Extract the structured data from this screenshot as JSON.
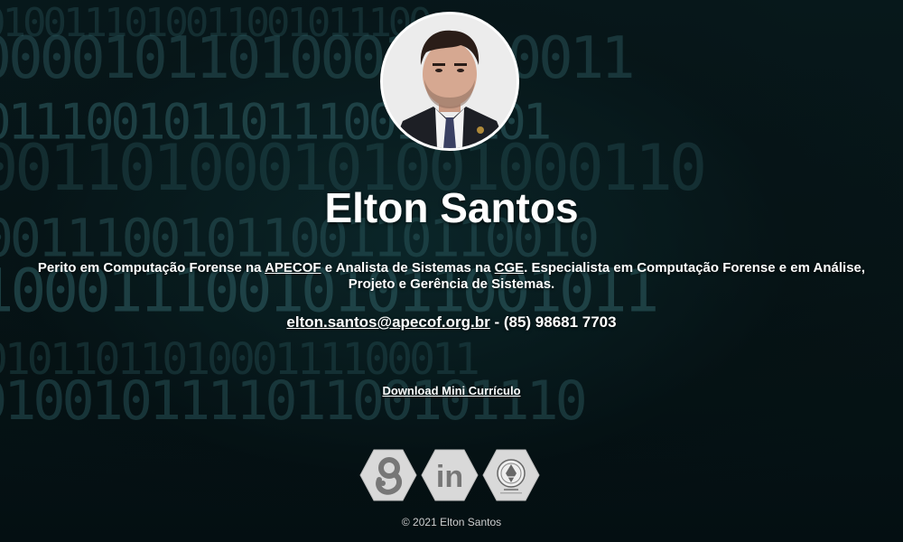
{
  "profile": {
    "name": "Elton Santos",
    "bio": {
      "t1": "Perito em Computação Forense na ",
      "link1": "APECOF",
      "t2": " e Analista de Sistemas na ",
      "link2": "CGE",
      "t3": ". Especialista em Computação Forense e em Análise, Projeto e Gerência de Sistemas."
    },
    "email": "elton.santos@apecof.org.br",
    "phone": " - (85) 98681 7703",
    "download_label": "Download Mini Currículo"
  },
  "social": [
    {
      "name": "lattes",
      "icon": "lattes-logo-icon"
    },
    {
      "name": "linkedin",
      "icon": "linkedin-icon",
      "glyph": "in"
    },
    {
      "name": "apecof",
      "icon": "apecof-seal-icon"
    }
  ],
  "footer": "© 2021 Elton Santos",
  "colors": {
    "background": "#0a1d20",
    "binary_text": "#3f7f86",
    "text": "#ffffff",
    "hex_fill": "#d9d9d9",
    "hex_icon": "#777777"
  },
  "background_digits": [
    "0 1 0 0 1 1 1 0 1 0 0 1 1 0 0 1 0 1 1 1 0 0",
    "1 0 0 0 0 1 0 1 1 0 1 0 0 0 1 1 0 1 0 0 1 1",
    "0 1 1 1 0 0 1 0 1 1 0 1 1 1 0 0 1 0 1 1 0 1",
    "1 0 0 1 1 0 1 0 0 0 1 0 1 0 0 1 0 0 0 1 1 0",
    "0 0 1 1 1 0 0 1 0 1 1 0 0 1 1 0 1 1 0 0 1 0",
    "1 1 0 0 0 1 1 1 0 0 1 0 1 0 1 1 0 0 1 0 1 1",
    "0 1 0 1 1 0 1 1 0 1 0 0 0 1 1 1 1 0 0 0 1 1",
    "1 0 1 0 0 1 0 1 1 1 1 0 1 1 0 0 1 0 1 1 1 0"
  ]
}
